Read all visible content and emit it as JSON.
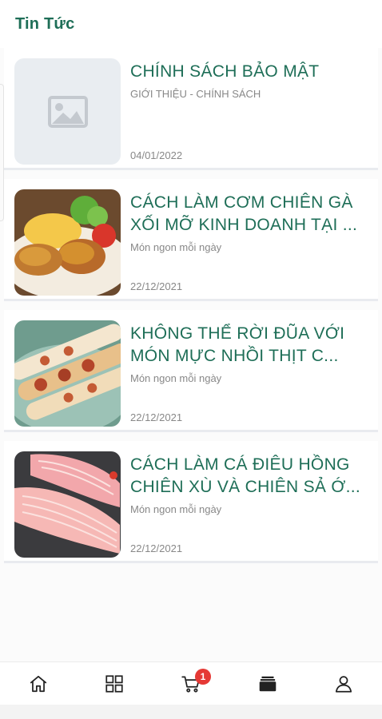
{
  "header": {
    "title": "Tin Tức"
  },
  "articles": [
    {
      "title": "CHÍNH SÁCH BẢO MẬT",
      "category": "GIỚI THIỆU - CHÍNH SÁCH",
      "date": "04/01/2022",
      "image": "image-placeholder-icon"
    },
    {
      "title": "CÁCH LÀM CƠM CHIÊN GÀ XỐI MỠ KINH DOANH TẠI ...",
      "category": "Món ngon mỗi ngày",
      "date": "22/12/2021",
      "image": "fried-chicken-rice-photo"
    },
    {
      "title": "KHÔNG THỂ RỜI ĐŨA VỚI MÓN MỰC NHỒI THỊT C...",
      "category": "Món ngon mỗi ngày",
      "date": "22/12/2021",
      "image": "stuffed-squid-photo"
    },
    {
      "title": "CÁCH LÀM CÁ ĐIÊU HỒNG CHIÊN XÙ VÀ CHIÊN SẢ Ớ...",
      "category": "Món ngon mỗi ngày",
      "date": "22/12/2021",
      "image": "tilapia-fillet-photo"
    }
  ],
  "bottom_nav": {
    "items": [
      {
        "icon": "home-icon"
      },
      {
        "icon": "grid-icon"
      },
      {
        "icon": "cart-icon",
        "badge": "1"
      },
      {
        "icon": "stack-icon"
      },
      {
        "icon": "user-icon"
      }
    ]
  },
  "colors": {
    "accent": "#1e6e57",
    "badge": "#e53935",
    "muted": "#888888"
  }
}
